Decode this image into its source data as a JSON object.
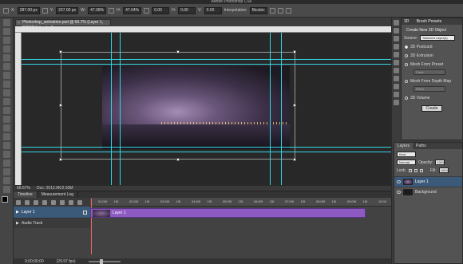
{
  "window": {
    "title": "Adobe Photoshop CS6"
  },
  "options_bar": {
    "x_value": "287.00 px",
    "y_value": "237.00 px",
    "w_value": "47.08%",
    "h_value": "47.04%",
    "angle_value": "0.00",
    "h_skew": "0.00",
    "v_skew": "0.00",
    "interpolation_label": "Interpolation:",
    "interpolation_value": "Bicubic"
  },
  "document": {
    "tab_title": "Photoshop_animation.psd @ 66.7% (Layer 1, RGB/8#) (scaled)"
  },
  "status": {
    "zoom": "66.67%",
    "doc_info": "Doc: 2012.0K/2.93M"
  },
  "timeline": {
    "tabs": [
      "Timeline",
      "Measurement Log"
    ],
    "time_labels": [
      "01:00f",
      "15f",
      "02:00f",
      "15f",
      "03:00f",
      "15f",
      "04:00f",
      "15f",
      "05:00f",
      "15f",
      "06:00f",
      "15f",
      "07:00f",
      "15f",
      "08:00f",
      "15f",
      "09:00f",
      "15f",
      "10:00"
    ],
    "layer_label": "Layer 1",
    "clip_label": "Layer 1",
    "audio_label": "Audio Track",
    "timecode": "0;00;00;00",
    "fps": "(29.97 fps)"
  },
  "panel_3d": {
    "tab": "3D",
    "tab2": "Brush Presets",
    "heading": "Create New 3D Object",
    "source_label": "Source:",
    "source_value": "Selected Layer(s)",
    "options": [
      {
        "label": "3D Postcard",
        "selected": true
      },
      {
        "label": "3D Extrusion",
        "selected": false
      },
      {
        "label": "Mesh From Preset",
        "selected": false
      },
      {
        "label": "Mesh From Depth Map",
        "selected": false
      },
      {
        "label": "3D Volume",
        "selected": false
      }
    ],
    "preset_value": "Cone",
    "depthmap_value": "Plane",
    "create_label": "Create"
  },
  "layers_panel": {
    "tabs": [
      "Layers",
      "Paths"
    ],
    "kind_label": "Kind",
    "blend_mode": "Normal",
    "opacity_label": "Opacity:",
    "opacity_value": "100%",
    "lock_label": "Lock:",
    "fill_label": "Fill:",
    "fill_value": "100%",
    "layers": [
      {
        "name": "Layer 1",
        "selected": true
      },
      {
        "name": "Background",
        "selected": false
      }
    ]
  },
  "colors": {
    "guide": "#34d6e6",
    "clip": "#8d5ac2",
    "selection": "#3b5a7a"
  }
}
